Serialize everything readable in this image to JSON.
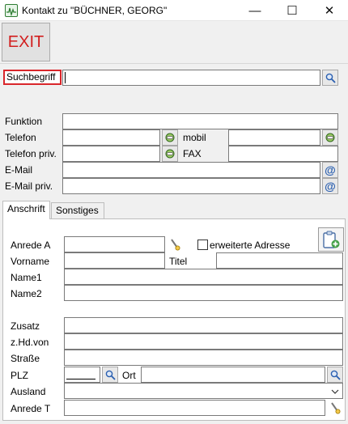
{
  "window": {
    "title": "Kontakt zu \"BÜCHNER, GEORG\"",
    "controls": {
      "minimize": "—",
      "maximize": "☐",
      "close": "✕"
    }
  },
  "toolbar": {
    "exit_label": "EXIT"
  },
  "search": {
    "label": "Suchbegriff",
    "value": ""
  },
  "contact": {
    "funktion_label": "Funktion",
    "telefon_label": "Telefon",
    "mobil_label": "mobil",
    "telefon_priv_label": "Telefon priv.",
    "fax_label": "FAX",
    "email_label": "E-Mail",
    "email_priv_label": "E-Mail priv."
  },
  "tabs": [
    {
      "label": "Anschrift",
      "active": true
    },
    {
      "label": "Sonstiges",
      "active": false
    }
  ],
  "address": {
    "anrede_a_label": "Anrede A",
    "erweiterte_adresse_label": "erweiterte Adresse",
    "erweiterte_adresse_checked": false,
    "vorname_label": "Vorname",
    "titel_label": "Titel",
    "name1_label": "Name1",
    "name2_label": "Name2",
    "zusatz_label": "Zusatz",
    "zhdvon_label": "z.Hd.von",
    "strasse_label": "Straße",
    "plz_label": "PLZ",
    "ort_label": "Ort",
    "ausland_label": "Ausland",
    "anrede_t_label": "Anrede T"
  },
  "icons": {
    "search": "magnifier-icon",
    "phone": "phone-icon",
    "email": "at-icon",
    "lookup": "pencil-lookup-icon",
    "clipboard": "clipboard-add-icon",
    "dropdown": "chevron-down-icon"
  },
  "colors": {
    "exit_text": "#d21f1f",
    "search_highlight": "#d9262b",
    "at_icon": "#2a5fb0"
  }
}
